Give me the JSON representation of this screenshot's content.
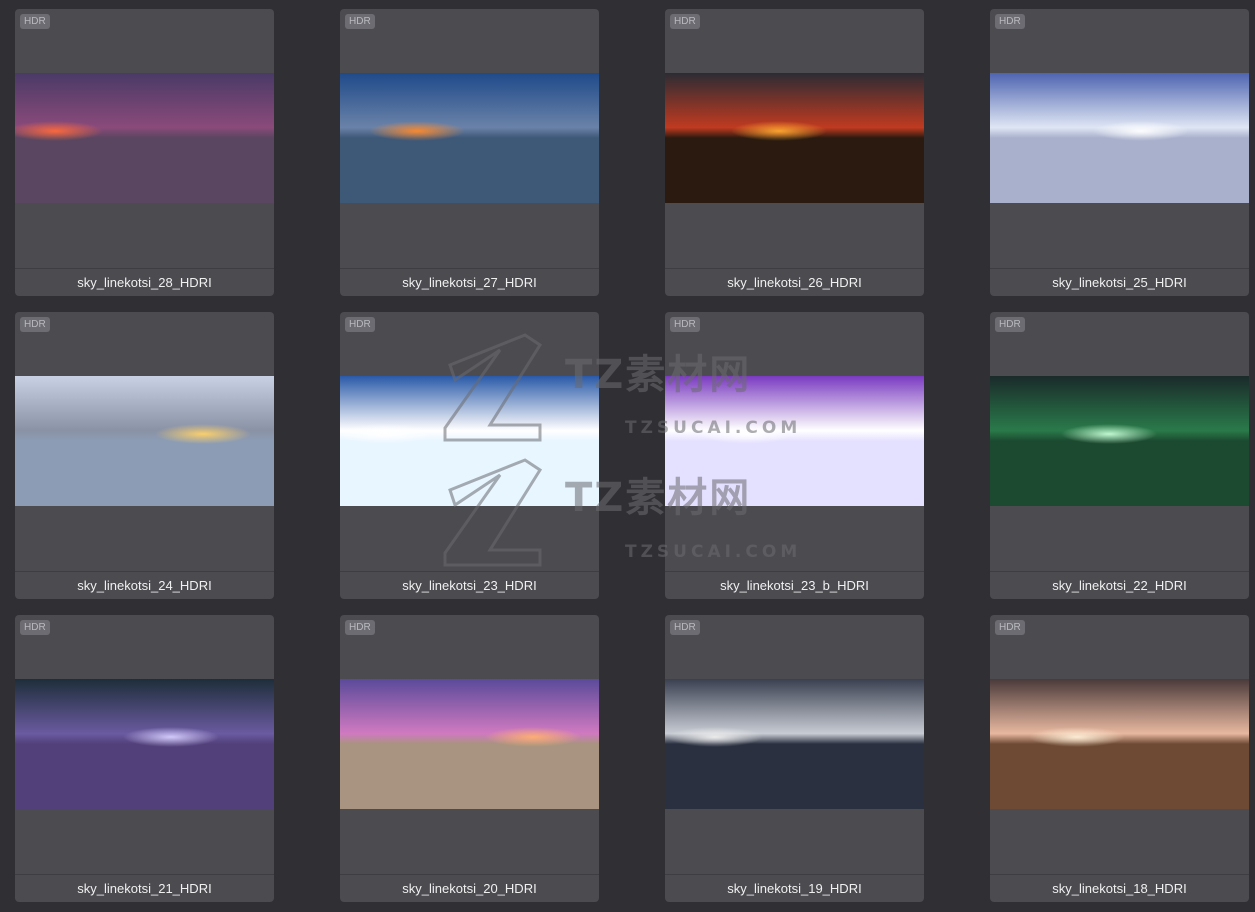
{
  "badge": "HDR",
  "cards": [
    {
      "label": "sky_linekotsi_28_HDRI",
      "palette": {
        "top": "#4a3a66",
        "mid": "#8a4a7a",
        "glow": "#ff6a3a",
        "ground": "#5a4660"
      }
    },
    {
      "label": "sky_linekotsi_27_HDRI",
      "palette": {
        "top": "#1f4a8a",
        "mid": "#6a82a8",
        "glow": "#ff8a2a",
        "ground": "#3e5878"
      }
    },
    {
      "label": "sky_linekotsi_26_HDRI",
      "palette": {
        "top": "#2c2c34",
        "mid": "#c03a20",
        "glow": "#ffaa30",
        "ground": "#2a1a10"
      }
    },
    {
      "label": "sky_linekotsi_25_HDRI",
      "palette": {
        "top": "#4e64b0",
        "mid": "#dfe6f4",
        "glow": "#ffffff",
        "ground": "#a8b0cc"
      }
    },
    {
      "label": "sky_linekotsi_24_HDRI",
      "palette": {
        "top": "#c8d2e4",
        "mid": "#8a92a6",
        "glow": "#ffd26a",
        "ground": "#8c9cb4"
      }
    },
    {
      "label": "sky_linekotsi_23_HDRI",
      "palette": {
        "top": "#2a5aa8",
        "mid": "#ffffff",
        "glow": "#ffffff",
        "ground": "#e8f6ff"
      }
    },
    {
      "label": "sky_linekotsi_23_b_HDRI",
      "palette": {
        "top": "#7a3ac0",
        "mid": "#ffffff",
        "glow": "#ffffff",
        "ground": "#e4e0ff"
      }
    },
    {
      "label": "sky_linekotsi_22_HDRI",
      "palette": {
        "top": "#1a2a2a",
        "mid": "#2a7a4a",
        "glow": "#c8ffd8",
        "ground": "#1c4a30"
      }
    },
    {
      "label": "sky_linekotsi_21_HDRI",
      "palette": {
        "top": "#1e2e3a",
        "mid": "#6a5aa0",
        "glow": "#d8d0ff",
        "ground": "#52407a"
      }
    },
    {
      "label": "sky_linekotsi_20_HDRI",
      "palette": {
        "top": "#5a4a9a",
        "mid": "#d07ac0",
        "glow": "#ffb070",
        "ground": "#a89480"
      }
    },
    {
      "label": "sky_linekotsi_19_HDRI",
      "palette": {
        "top": "#3a4050",
        "mid": "#c8ccd4",
        "glow": "#f0f0f0",
        "ground": "#2a3040"
      }
    },
    {
      "label": "sky_linekotsi_18_HDRI",
      "palette": {
        "top": "#4a3a3a",
        "mid": "#e8b8a0",
        "glow": "#fff0d8",
        "ground": "#6e4a34"
      }
    }
  ],
  "watermark": {
    "brand_1": "TZ素材网",
    "domain_1": "TZSUCAI.COM",
    "brand_2": "TZ素材网",
    "domain_2": "TZSUCAI.COM"
  }
}
